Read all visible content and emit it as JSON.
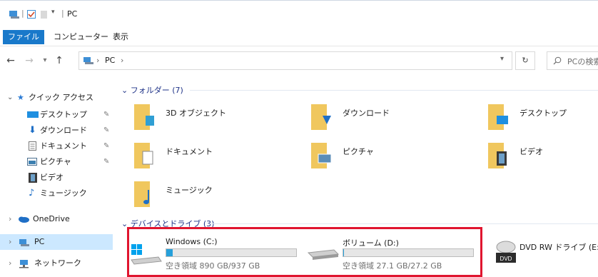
{
  "window": {
    "title": "PC"
  },
  "ribbon": {
    "tabs": [
      "ファイル",
      "コンピューター",
      "表示"
    ]
  },
  "address": {
    "path": [
      "PC"
    ],
    "search_placeholder": "PCの検索"
  },
  "nav": {
    "quick_access": "クイック アクセス",
    "items": [
      {
        "label": "デスクトップ",
        "icon": "desktop-icon",
        "pinned": true
      },
      {
        "label": "ダウンロード",
        "icon": "download-icon",
        "pinned": true
      },
      {
        "label": "ドキュメント",
        "icon": "document-icon",
        "pinned": true
      },
      {
        "label": "ピクチャ",
        "icon": "picture-icon",
        "pinned": true
      },
      {
        "label": "ビデオ",
        "icon": "video-icon",
        "pinned": false
      },
      {
        "label": "ミュージック",
        "icon": "music-icon",
        "pinned": false
      }
    ],
    "onedrive": "OneDrive",
    "pc": "PC",
    "network": "ネットワーク"
  },
  "folders": {
    "header": "フォルダー (7)",
    "items": [
      {
        "label": "3D オブジェクト",
        "icon": "3d-objects-folder-icon"
      },
      {
        "label": "ダウンロード",
        "icon": "downloads-folder-icon"
      },
      {
        "label": "デスクトップ",
        "icon": "desktop-folder-icon"
      },
      {
        "label": "ドキュメント",
        "icon": "documents-folder-icon"
      },
      {
        "label": "ピクチャ",
        "icon": "pictures-folder-icon"
      },
      {
        "label": "ビデオ",
        "icon": "videos-folder-icon"
      },
      {
        "label": "ミュージック",
        "icon": "music-folder-icon"
      }
    ]
  },
  "drives": {
    "header": "デバイスとドライブ (3)",
    "items": [
      {
        "label": "Windows (C:)",
        "free": "空き領域 890 GB/937 GB",
        "used_fraction": 0.05
      },
      {
        "label": "ボリューム (D:)",
        "free": "空き領域 27.1 GB/27.2 GB",
        "used_fraction": 0.004
      },
      {
        "label": "DVD RW ドライブ (E:)"
      }
    ]
  },
  "colors": {
    "accent": "#1979ca",
    "selection": "#cce8ff",
    "highlight_box": "#e0152f",
    "bar_fill": "#26a0da"
  }
}
